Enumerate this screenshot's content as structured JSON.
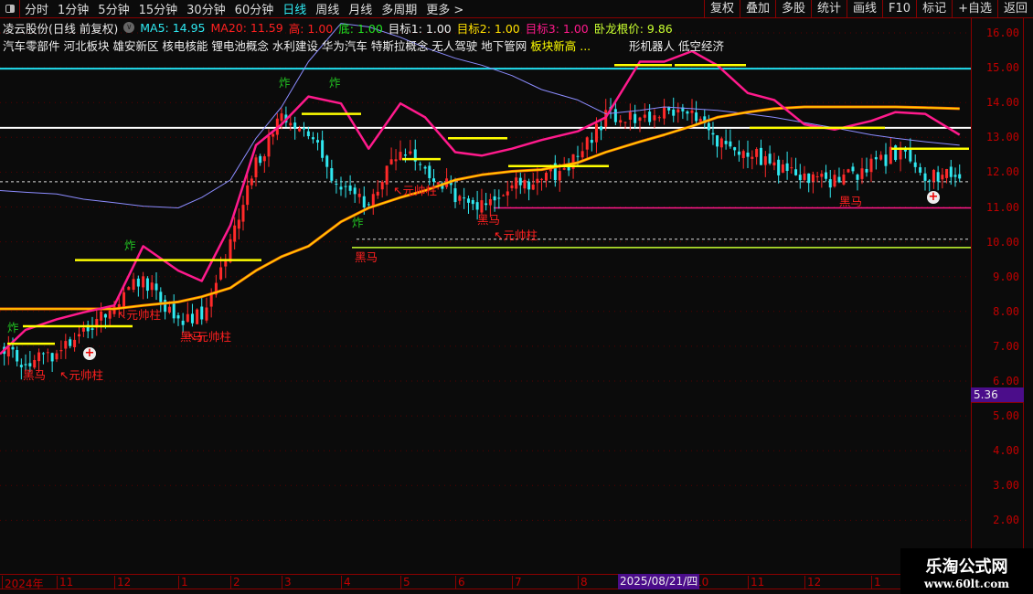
{
  "topbar": {
    "periods": [
      "分时",
      "1分钟",
      "5分钟",
      "15分钟",
      "30分钟",
      "60分钟",
      "日线",
      "周线",
      "月线",
      "多周期",
      "更多 >"
    ],
    "active": "日线",
    "tools": [
      "复权",
      "叠加",
      "多股",
      "统计",
      "画线",
      "F10",
      "标记",
      "+自选",
      "返回"
    ]
  },
  "info": {
    "title": "凌云股份(日线 前复权)",
    "ma5": "MA5: 14.95",
    "ma20": "MA20: 11.59",
    "high": "高: 1.00",
    "bottom": "底: 1.00",
    "target1": "目标1: 1.00",
    "target2": "目标2: 1.00",
    "target3": "目标3: 1.00",
    "wolong": "卧龙根价: 9.86"
  },
  "sectors": {
    "white": "汽车零部件 河北板块 雄安新区 核电核能 锂电池概念 水利建设 华为汽车 特斯拉概念 无人驾驶 地下管网",
    "overlap": "板块新高 ...",
    "tail": "形机器人 低空经济"
  },
  "axis": {
    "ticks": [
      "16.00",
      "15.00",
      "14.00",
      "13.00",
      "12.00",
      "11.00",
      "10.00",
      "9.00",
      "8.00",
      "7.00",
      "6.00",
      "5.00",
      "4.00",
      "3.00",
      "2.00"
    ],
    "current": "5.36"
  },
  "datebar": {
    "months": [
      "2024年",
      "11",
      "12",
      "1",
      "2",
      "3",
      "4",
      "5",
      "6",
      "7",
      "8",
      "10",
      "11",
      "12",
      "1"
    ],
    "highlight": "2025/08/21/四"
  },
  "labels": {
    "heima": "黑马",
    "yuanshuai": "↖元帅柱",
    "yuanshuai2": "元帅柱",
    "zha": "炸"
  },
  "watermark": {
    "name": "乐淘公式网",
    "url": "www.60lt.com"
  },
  "colors": {
    "up": "#ff2a2a",
    "down": "#30e8f0",
    "ma_long": "#ffd000",
    "band": "#ff1a8c",
    "blue": "#8c8cff",
    "level_cyan": "#20e0f0",
    "level_white": "#ffffff",
    "wolong": "#c8ff30",
    "magenta": "#ff1a8c"
  },
  "chart_data": {
    "type": "candlestick-with-indicators",
    "ylim": [
      1,
      16.3
    ],
    "dates": [
      "2024-10-01",
      "2024-10-15",
      "2024-11-01",
      "2024-11-15",
      "2024-12-01",
      "2024-12-15",
      "2025-01-01",
      "2025-01-15",
      "2025-02-01",
      "2025-02-15",
      "2025-03-01",
      "2025-03-15",
      "2025-04-01",
      "2025-04-15",
      "2025-05-01",
      "2025-05-15",
      "2025-06-01",
      "2025-06-15",
      "2025-07-01",
      "2025-07-15",
      "2025-08-01",
      "2025-08-15",
      "2025-09-01",
      "2025-09-15",
      "2025-10-01",
      "2025-10-15",
      "2025-11-01",
      "2025-11-15",
      "2025-12-01",
      "2025-12-15",
      "2026-01-01",
      "2026-01-15",
      "2026-02-01",
      "2026-02-13"
    ],
    "close": [
      7.0,
      6.6,
      6.8,
      7.4,
      8.3,
      9.0,
      7.8,
      8.0,
      9.9,
      12.2,
      13.6,
      13.1,
      11.5,
      11.2,
      12.8,
      12.1,
      11.4,
      11.0,
      11.7,
      11.8,
      12.4,
      13.6,
      13.6,
      13.8,
      13.6,
      13.0,
      12.6,
      12.2,
      11.8,
      11.8,
      12.2,
      12.6,
      12.0,
      11.8
    ],
    "ma_long": [
      8.1,
      8.1,
      8.1,
      8.1,
      8.1,
      8.2,
      8.3,
      8.45,
      8.7,
      9.2,
      9.6,
      9.9,
      10.6,
      11.0,
      11.3,
      11.5,
      11.8,
      11.95,
      12.05,
      12.1,
      12.3,
      12.6,
      12.9,
      13.1,
      13.35,
      13.6,
      13.75,
      13.85,
      13.9,
      13.9,
      13.9,
      13.9,
      13.88,
      13.85
    ],
    "band": [
      6.8,
      7.5,
      7.8,
      8.0,
      8.2,
      9.9,
      9.2,
      8.9,
      10.5,
      12.8,
      13.4,
      14.2,
      14.0,
      12.7,
      14.0,
      13.6,
      12.6,
      12.5,
      12.7,
      12.95,
      13.2,
      13.6,
      15.2,
      15.2,
      15.5,
      15.1,
      14.3,
      14.1,
      13.4,
      13.25,
      13.5,
      13.75,
      13.7,
      13.1
    ],
    "blue": [
      11.5,
      11.45,
      11.4,
      11.25,
      11.15,
      11.05,
      11.0,
      11.3,
      11.8,
      13.0,
      13.9,
      15.2,
      16.3,
      16.2,
      15.9,
      15.6,
      15.3,
      15.1,
      14.8,
      14.4,
      14.1,
      13.7,
      13.8,
      13.9,
      13.85,
      13.8,
      13.7,
      13.6,
      13.45,
      13.3,
      13.1,
      13.0,
      12.9,
      12.8
    ],
    "levels": {
      "cyan": 15.0,
      "white": 13.3,
      "white_dashed": 11.75,
      "magenta": 11.0,
      "white_dashed_low": 10.1,
      "wolong": 9.86
    }
  }
}
